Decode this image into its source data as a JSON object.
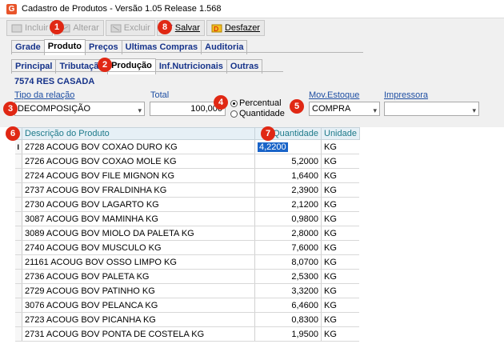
{
  "window": {
    "icon_letter": "G",
    "title": "Cadastro de Produtos - Versão 1.05 Release 1.568"
  },
  "toolbar": {
    "incluir": "Incluir",
    "alterar": "Alterar",
    "excluir": "Excluir",
    "salvar": "Salvar",
    "desfazer": "Desfazer"
  },
  "main_tabs": [
    "Grade",
    "Produto",
    "Preços",
    "Ultimas Compras",
    "Auditoria"
  ],
  "sub_tabs": [
    "Principal",
    "Tributação",
    "Produção",
    "Inf.Nutricionais",
    "Outras"
  ],
  "product_code": "7574 RES CASADA",
  "form": {
    "tipo_relacao_label": "Tipo da relação",
    "tipo_relacao_value": "DECOMPOSIÇÃO",
    "total_label": "Total",
    "total_value": "100,000",
    "radio_percentual": "Percentual",
    "radio_quantidade": "Quantidade",
    "mov_estoque_label": "Mov.Estoque",
    "mov_estoque_value": "COMPRA",
    "impressora_label": "Impressora",
    "impressora_value": ""
  },
  "grid": {
    "headers": {
      "descricao": "Descrição do Produto",
      "quantidade": "Quantidade",
      "unidade": "Unidade"
    },
    "rows": [
      {
        "descricao": "2728 ACOUG BOV COXAO DURO KG",
        "quantidade": "4,2200",
        "unidade": "KG"
      },
      {
        "descricao": "2726 ACOUG BOV COXAO MOLE KG",
        "quantidade": "5,2000",
        "unidade": "KG"
      },
      {
        "descricao": "2724 ACOUG BOV FILE MIGNON KG",
        "quantidade": "1,6400",
        "unidade": "KG"
      },
      {
        "descricao": "2737 ACOUG BOV FRALDINHA KG",
        "quantidade": "2,3900",
        "unidade": "KG"
      },
      {
        "descricao": "2730 ACOUG BOV LAGARTO KG",
        "quantidade": "2,1200",
        "unidade": "KG"
      },
      {
        "descricao": "3087 ACOUG BOV MAMINHA KG",
        "quantidade": "0,9800",
        "unidade": "KG"
      },
      {
        "descricao": "3089 ACOUG BOV MIOLO DA PALETA KG",
        "quantidade": "2,8000",
        "unidade": "KG"
      },
      {
        "descricao": "2740 ACOUG BOV MUSCULO KG",
        "quantidade": "7,6000",
        "unidade": "KG"
      },
      {
        "descricao": "21161 ACOUG BOV OSSO LIMPO KG",
        "quantidade": "8,0700",
        "unidade": "KG"
      },
      {
        "descricao": "2736 ACOUG BOV PALETA KG",
        "quantidade": "2,5300",
        "unidade": "KG"
      },
      {
        "descricao": "2729 ACOUG BOV PATINHO KG",
        "quantidade": "3,3200",
        "unidade": "KG"
      },
      {
        "descricao": "3076 ACOUG BOV PELANCA KG",
        "quantidade": "6,4600",
        "unidade": "KG"
      },
      {
        "descricao": "2723 ACOUG BOV PICANHA KG",
        "quantidade": "0,8300",
        "unidade": "KG"
      },
      {
        "descricao": "2731 ACOUG BOV PONTA DE COSTELA KG",
        "quantidade": "1,9500",
        "unidade": "KG"
      }
    ]
  },
  "badges": [
    "1",
    "2",
    "3",
    "4",
    "5",
    "6",
    "7",
    "8"
  ],
  "colors": {
    "badge": "#e02814",
    "tab_text": "#16338a",
    "label": "#1f4fa3",
    "grid_header_text": "#1e7a8a",
    "selection": "#1a64c8"
  }
}
